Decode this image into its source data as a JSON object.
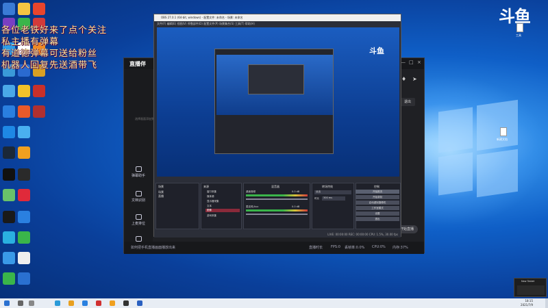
{
  "overlay_text": {
    "line1": "各位老铁好来了点个关注",
    "line2": "私主播有弹幕",
    "line3": "有道德弹幕可送给粉丝",
    "line4": "机器人回复先送酒带飞"
  },
  "douyu_logo": "斗鱼",
  "desktop_files": {
    "top_file": "工具",
    "right_file": "新建文档"
  },
  "stream_app": {
    "logo": "直播伴",
    "sidebar": [
      {
        "label": "弹幕助手"
      },
      {
        "label": "文档识别"
      },
      {
        "label": "上麦排位"
      }
    ],
    "exit_label": "退出",
    "start_live": "开始直播",
    "tools": [
      {
        "label": "直播间设置"
      },
      {
        "label": "弹幕姬"
      },
      {
        "label": "开启连麦"
      },
      {
        "label": "贴纸"
      },
      {
        "label": "麦克风"
      },
      {
        "label": "扬声器"
      }
    ],
    "bottom_hint": "如何把手机直播画面播放出来",
    "status": [
      "直播时长",
      "FPS:0",
      "丢帧率:0.0%",
      "CPU:0%",
      "内存:37%"
    ],
    "side_text": "选择画面添加到此"
  },
  "obs": {
    "title": "OBS 27.0.1 (64-bit, windows) - 配置文件: 未命名 - 场景: 未命名",
    "menu": "文件(F)  编辑(E)  视图(V)  停靠部件(D)  配置文件(P)  场景集合(S)  工具(T)  帮助(H)",
    "docks": {
      "scenes": "场景",
      "sources": "来源",
      "mixer": "混音器",
      "transitions": "转场特效",
      "controls": "控制"
    },
    "scene_items": [
      "场景",
      "直播"
    ],
    "source_items": [
      "窗口采集",
      "媒体源",
      "显示器采集",
      "文本",
      "图像",
      "游戏采集"
    ],
    "mixer_tracks": [
      {
        "name": "桌面音频",
        "level": "0.0 dB"
      },
      {
        "name": "麦克风/Aux",
        "level": "0.0 dB"
      }
    ],
    "transition_value": "淡出",
    "duration_label": "时长",
    "duration_value": "300 ms",
    "controls": [
      "开始推流",
      "开始录制",
      "启动虚拟摄像机",
      "工作室模式",
      "设置",
      "退出"
    ],
    "status_bar": "LIVE: 00:00:00   REC: 00:00:00   CPU: 1.5%, 30.00 fps"
  },
  "taskbar": {
    "time": "18:15",
    "date": "2021/7/9"
  },
  "notification": {
    "title": "New Tablet"
  },
  "colors": {
    "obs_bg": "#2b2e38",
    "stream_bg": "#1f2024",
    "wallpaper": "#0f5fc7",
    "overlay_text": "#f3e6a0"
  }
}
